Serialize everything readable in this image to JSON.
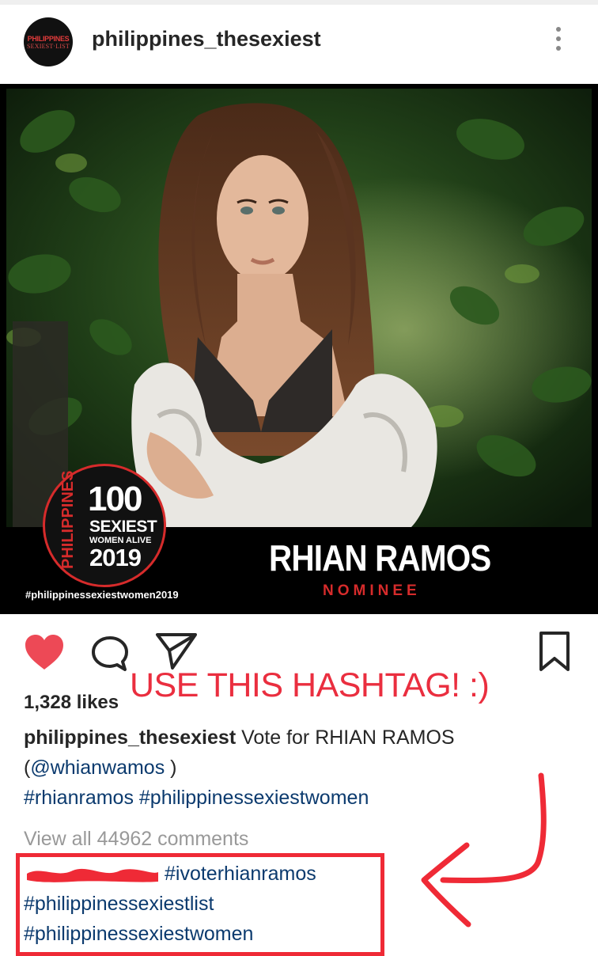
{
  "header": {
    "avatar_line1": "PHILIPPINES",
    "avatar_line2": "SEXIEST·LIST",
    "username": "philippines_thesexiest",
    "more_icon": "more-vertical-icon"
  },
  "photo": {
    "badge": {
      "vertical": "PHILIPPINES",
      "number": "100",
      "line1": "SEXIEST",
      "line2": "WOMEN ALIVE",
      "year": "2019"
    },
    "name": "RHIAN RAMOS",
    "subtitle": "NOMINEE",
    "hashtag": "#philippinessexiestwomen2019"
  },
  "actions": {
    "like_icon": "heart-filled-icon",
    "comment_icon": "comment-icon",
    "share_icon": "send-icon",
    "save_icon": "bookmark-icon",
    "like_color": "#ed4956"
  },
  "annotation": {
    "text": "USE THIS HASHTAG! :)",
    "color": "#ea2e3f"
  },
  "post": {
    "likes": "1,328 likes",
    "caption_user": "philippines_thesexiest",
    "caption_text": " Vote for RHIAN RAMOS",
    "mention_open": "(",
    "mention": "@whianwamos",
    "mention_close": " )",
    "tag1": "#rhianramos",
    "tag2": "#philippinessexiestwomen",
    "view_all": "View all 44962 comments"
  },
  "comment": {
    "tag1": "#ivoterhianramos",
    "tag2": "#philippinessexiestlist",
    "tag3": "#philippinessexiestwomen"
  }
}
